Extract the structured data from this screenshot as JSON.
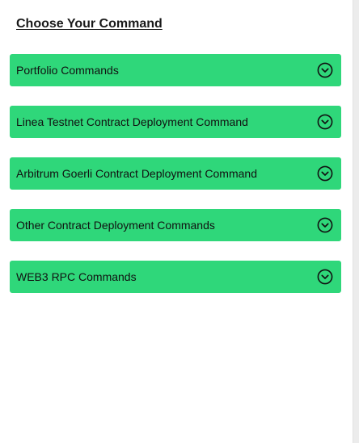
{
  "page": {
    "title": "Choose Your Command"
  },
  "commands": [
    {
      "label": "Portfolio Commands",
      "icon": "chevron-down-circle-icon"
    },
    {
      "label": "Linea Testnet Contract Deployment Command",
      "icon": "chevron-down-circle-icon"
    },
    {
      "label": "Arbitrum Goerli Contract Deployment Command",
      "icon": "chevron-down-circle-icon"
    },
    {
      "label": "Other Contract Deployment Commands",
      "icon": "chevron-down-circle-icon"
    },
    {
      "label": "WEB3 RPC Commands",
      "icon": "chevron-down-circle-icon"
    }
  ],
  "colors": {
    "accent": "#2fd77a",
    "text": "#111111"
  }
}
